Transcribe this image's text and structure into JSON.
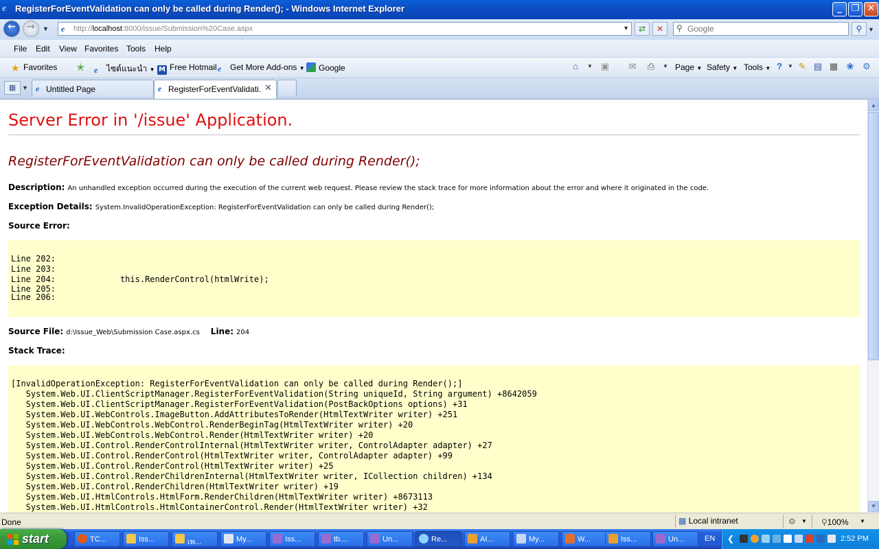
{
  "window": {
    "title": "RegisterForEventValidation can only be called during Render(); - Windows Internet Explorer",
    "minimize": "_",
    "maximize": "❐",
    "close": "✕"
  },
  "address": {
    "url_prefix": "http://",
    "url_host": "localhost",
    "url_rest": ":8000/issue/Submission%20Case.aspx",
    "search_placeholder": "Google"
  },
  "menu": [
    "File",
    "Edit",
    "View",
    "Favorites",
    "Tools",
    "Help"
  ],
  "favorites_bar": {
    "favorites_label": "Favorites",
    "items": [
      "ไซต์แนะนำ",
      "Free Hotmail",
      "Get More Add-ons",
      "Google"
    ]
  },
  "command_bar": {
    "page": "Page",
    "safety": "Safety",
    "tools": "Tools"
  },
  "tabs": [
    {
      "label": "Untitled Page"
    },
    {
      "label": "RegisterForEventValidati..."
    }
  ],
  "page": {
    "heading": "Server Error in '/issue' Application.",
    "error_title": "RegisterForEventValidation can only be called during Render();",
    "description_label": "Description:",
    "description": "An unhandled exception occurred during the execution of the current web request. Please review the stack trace for more information about the error and where it originated in the code.",
    "exception_label": "Exception Details:",
    "exception": "System.InvalidOperationException: RegisterForEventValidation can only be called during Render();",
    "source_error_label": "Source Error:",
    "source_lines_before": "Line 202:\nLine 203:",
    "source_line_error": "Line 204:             this.RenderControl(htmlWrite);",
    "source_lines_after": "Line 205:\nLine 206:",
    "source_file_label": "Source File:",
    "source_file": "d:\\Issue_Web\\Submission Case.aspx.cs",
    "line_label": "Line:",
    "line_number": "204",
    "stack_trace_label": "Stack Trace:",
    "stack_trace": "[InvalidOperationException: RegisterForEventValidation can only be called during Render();]\n   System.Web.UI.ClientScriptManager.RegisterForEventValidation(String uniqueId, String argument) +8642059\n   System.Web.UI.ClientScriptManager.RegisterForEventValidation(PostBackOptions options) +31\n   System.Web.UI.WebControls.ImageButton.AddAttributesToRender(HtmlTextWriter writer) +251\n   System.Web.UI.WebControls.WebControl.RenderBeginTag(HtmlTextWriter writer) +20\n   System.Web.UI.WebControls.WebControl.Render(HtmlTextWriter writer) +20\n   System.Web.UI.Control.RenderControlInternal(HtmlTextWriter writer, ControlAdapter adapter) +27\n   System.Web.UI.Control.RenderControl(HtmlTextWriter writer, ControlAdapter adapter) +99\n   System.Web.UI.Control.RenderControl(HtmlTextWriter writer) +25\n   System.Web.UI.Control.RenderChildrenInternal(HtmlTextWriter writer, ICollection children) +134\n   System.Web.UI.Control.RenderChildren(HtmlTextWriter writer) +19\n   System.Web.UI.HtmlControls.HtmlForm.RenderChildren(HtmlTextWriter writer) +8673113\n   System.Web.UI.HtmlControls.HtmlContainerControl.Render(HtmlTextWriter writer) +32"
  },
  "status": {
    "text": "Done",
    "zone": "Local intranet",
    "zoom": "100%"
  },
  "taskbar": {
    "start": "start",
    "tasks": [
      "TC...",
      "Iss...",
      "เพ...",
      "My...",
      "Iss...",
      "tb....",
      "Un...",
      "Re...",
      "AI...",
      "My...",
      "W...",
      "Iss...",
      "Un..."
    ],
    "language": "EN",
    "clock": "2:52 PM"
  }
}
